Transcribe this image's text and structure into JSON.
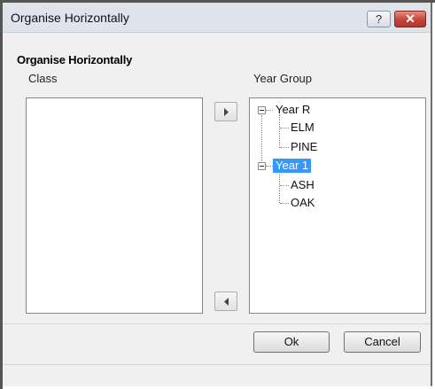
{
  "window": {
    "title": "Organise Horizontally",
    "help_label": "?",
    "close_label": "✕"
  },
  "header": {
    "title": "Organise Horizontally"
  },
  "class_panel": {
    "label": "Class",
    "items": []
  },
  "year_group_panel": {
    "label": "Year Group",
    "tree": [
      {
        "label": "Year  R",
        "children": [
          "ELM",
          "PINE"
        ]
      },
      {
        "label": "Year  1",
        "selected": true,
        "children": [
          "ASH",
          "OAK"
        ]
      }
    ]
  },
  "buttons": {
    "ok": "Ok",
    "cancel": "Cancel"
  },
  "icons": {
    "help": "help-icon",
    "close": "close-icon",
    "move_right": "triangle-right-icon",
    "move_left": "triangle-left-icon",
    "collapse": "minus-box-icon"
  },
  "colors": {
    "selection": "#3399ff",
    "close_button": "#c5443a"
  }
}
